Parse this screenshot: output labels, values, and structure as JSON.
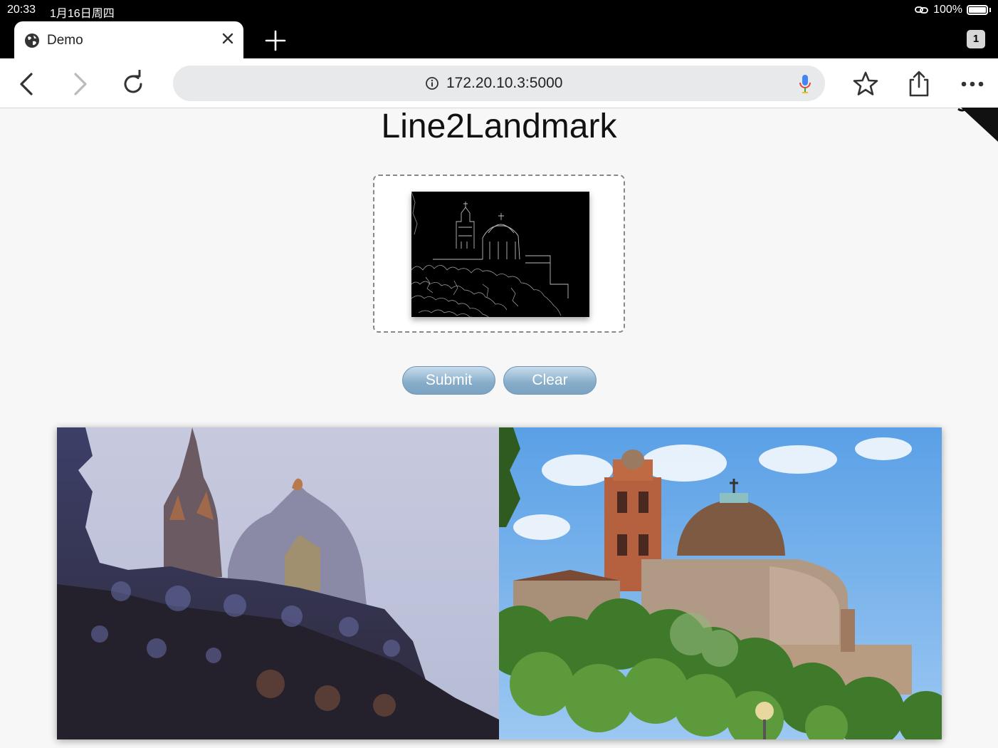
{
  "status_bar": {
    "time": "20:33",
    "date": "1月16日周四",
    "battery": "100%"
  },
  "browser": {
    "tab_title": "Demo",
    "tab_count": "1",
    "url": "172.20.10.3:5000"
  },
  "page": {
    "title": "Line2Landmark",
    "submit_label": "Submit",
    "clear_label": "Clear"
  },
  "colors": {
    "button": "#86acc9",
    "page_bg": "#f7f7f7"
  }
}
